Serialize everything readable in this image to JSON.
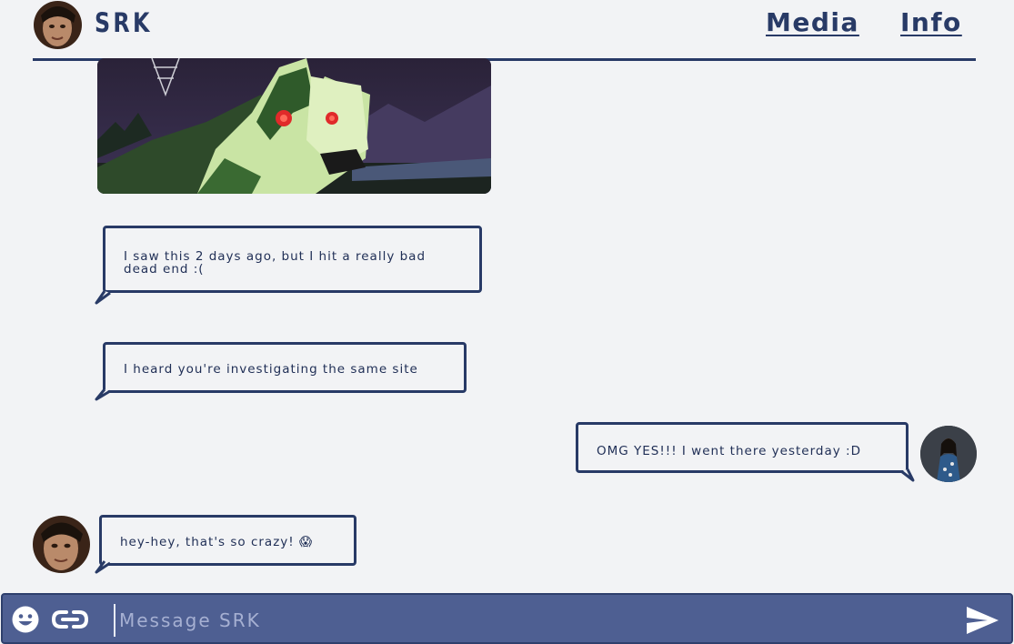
{
  "header": {
    "title": "SRK",
    "nav": [
      {
        "label": "Media"
      },
      {
        "label": "Info"
      }
    ]
  },
  "messages": [
    {
      "sender": "SRK",
      "text": "I saw this 2 days ago, but I hit a really bad dead end :("
    },
    {
      "sender": "SRK",
      "text": "I heard you're investigating the same site"
    },
    {
      "sender": "me",
      "text": "OMG YES!!! I went there yesterday :D"
    },
    {
      "sender": "SRK",
      "text": "hey-hey, that's so crazy! 😱"
    }
  ],
  "composer": {
    "placeholder": "Message SRK",
    "emoji_icon": "smiley-icon",
    "attach_icon": "link-icon",
    "send_icon": "send-icon"
  },
  "colors": {
    "accent": "#283a66",
    "composer_bg": "#4e5f92",
    "page_bg": "#f2f3f5"
  }
}
